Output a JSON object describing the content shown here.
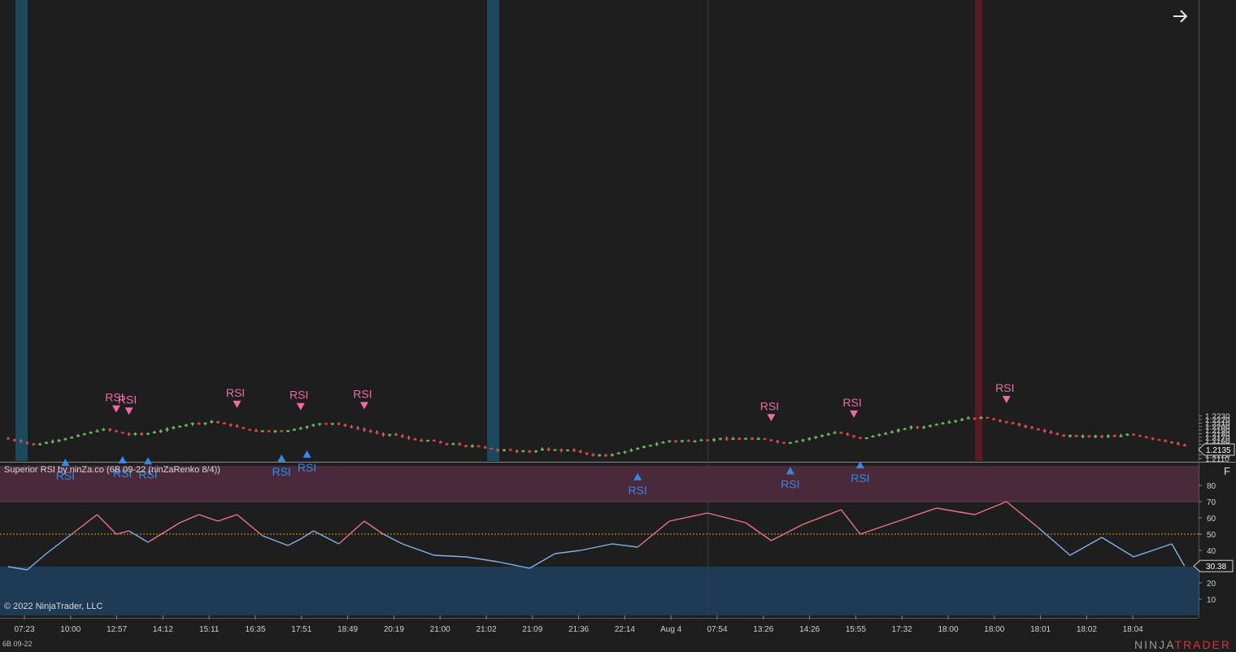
{
  "colors": {
    "background": "#1e1e1e",
    "up_candle": "#5fba4f",
    "down_candle": "#e8373f",
    "wick": "#cfcfcf",
    "signal_buy": "#2f8bea",
    "signal_sell": "#ee6aa7",
    "session_band_blue": "#1b4a5e",
    "session_band_red": "#5a1a24",
    "overbought_zone": "#4a2a3a",
    "oversold_zone": "#1f3a55",
    "midline": "#d8a032",
    "rsi_high": "#e8738a",
    "rsi_low": "#7fb2e6"
  },
  "price_axis": {
    "min": 1.2103,
    "max": 1.2233,
    "ticks": [
      "1.2110",
      "1.2120",
      "1.2130",
      "1.2140",
      "1.2150",
      "1.2160",
      "1.2170",
      "1.2180",
      "1.2190",
      "1.2200",
      "1.2210",
      "1.2220",
      "1.2230"
    ],
    "current_price": "1.2135",
    "current_value": 1.2135
  },
  "time_axis": {
    "labels": [
      "07:23",
      "10:00",
      "12:57",
      "14:12",
      "15:11",
      "16:35",
      "17:51",
      "18:49",
      "20:19",
      "21:00",
      "21:02",
      "21:09",
      "21:36",
      "22:14",
      "Aug 4",
      "07:54",
      "13:26",
      "14:26",
      "15:55",
      "17:32",
      "18:00",
      "18:00",
      "18:01",
      "18:02",
      "18:04"
    ]
  },
  "signals": {
    "label": "RSI",
    "buy_bars": [
      9,
      18,
      22,
      43,
      47,
      99,
      123,
      134
    ],
    "sell_bars": [
      17,
      19,
      36,
      46,
      56,
      120,
      133,
      157
    ]
  },
  "price_path_anchors": [
    [
      0,
      1.2168
    ],
    [
      3,
      1.215
    ],
    [
      6,
      1.2152
    ],
    [
      10,
      1.2181
    ],
    [
      15,
      1.2197
    ],
    [
      18,
      1.2181
    ],
    [
      22,
      1.2178
    ],
    [
      27,
      1.2202
    ],
    [
      33,
      1.2214
    ],
    [
      38,
      1.219
    ],
    [
      44,
      1.2185
    ],
    [
      48,
      1.2201
    ],
    [
      52,
      1.2211
    ],
    [
      56,
      1.2196
    ],
    [
      61,
      1.2176
    ],
    [
      67,
      1.2158
    ],
    [
      72,
      1.2147
    ],
    [
      78,
      1.2135
    ],
    [
      82,
      1.213
    ],
    [
      86,
      1.2137
    ],
    [
      90,
      1.213
    ],
    [
      95,
      1.2117
    ],
    [
      99,
      1.2133
    ],
    [
      104,
      1.2158
    ],
    [
      110,
      1.2162
    ],
    [
      115,
      1.2168
    ],
    [
      120,
      1.2162
    ],
    [
      123,
      1.215
    ],
    [
      128,
      1.2174
    ],
    [
      131,
      1.2182
    ],
    [
      134,
      1.2167
    ],
    [
      139,
      1.2185
    ],
    [
      146,
      1.2203
    ],
    [
      153,
      1.2225
    ],
    [
      157,
      1.2213
    ],
    [
      162,
      1.219
    ],
    [
      167,
      1.2177
    ],
    [
      172,
      1.2171
    ],
    [
      177,
      1.2176
    ],
    [
      183,
      1.2152
    ],
    [
      185,
      1.2137
    ]
  ],
  "indicator": {
    "title": "Superior RSI by ninZa.co (6B 09-22 (ninZaRenko 8/4))",
    "axis_ticks": [
      "10",
      "20",
      "30",
      "40",
      "50",
      "60",
      "70",
      "80"
    ],
    "current_value": "30.38",
    "current_value_num": 30.38,
    "overbought": 70,
    "oversold": 30,
    "midline": 50,
    "series": [
      [
        0,
        30
      ],
      [
        3,
        28
      ],
      [
        6,
        38
      ],
      [
        10,
        50
      ],
      [
        14,
        62
      ],
      [
        17,
        50
      ],
      [
        19,
        52
      ],
      [
        22,
        45
      ],
      [
        27,
        57
      ],
      [
        30,
        62
      ],
      [
        33,
        58
      ],
      [
        36,
        62
      ],
      [
        40,
        49
      ],
      [
        44,
        43
      ],
      [
        46,
        47
      ],
      [
        48,
        52
      ],
      [
        52,
        44
      ],
      [
        56,
        58
      ],
      [
        59,
        50
      ],
      [
        62,
        44
      ],
      [
        67,
        37
      ],
      [
        72,
        36
      ],
      [
        77,
        33
      ],
      [
        82,
        29
      ],
      [
        86,
        38
      ],
      [
        90,
        40
      ],
      [
        95,
        44
      ],
      [
        99,
        42
      ],
      [
        104,
        58
      ],
      [
        110,
        63
      ],
      [
        116,
        57
      ],
      [
        120,
        46
      ],
      [
        125,
        56
      ],
      [
        131,
        65
      ],
      [
        134,
        50
      ],
      [
        140,
        58
      ],
      [
        146,
        66
      ],
      [
        152,
        62
      ],
      [
        157,
        70
      ],
      [
        162,
        54
      ],
      [
        167,
        37
      ],
      [
        172,
        48
      ],
      [
        177,
        36
      ],
      [
        183,
        44
      ],
      [
        185,
        30.38
      ]
    ]
  },
  "footer": {
    "copyright": "© 2022 NinjaTrader, LLC",
    "instrument": "6B 09-22",
    "brand_left": "NINJA",
    "brand_right": "TRADER"
  },
  "toolbar": {
    "f_label": "F"
  }
}
